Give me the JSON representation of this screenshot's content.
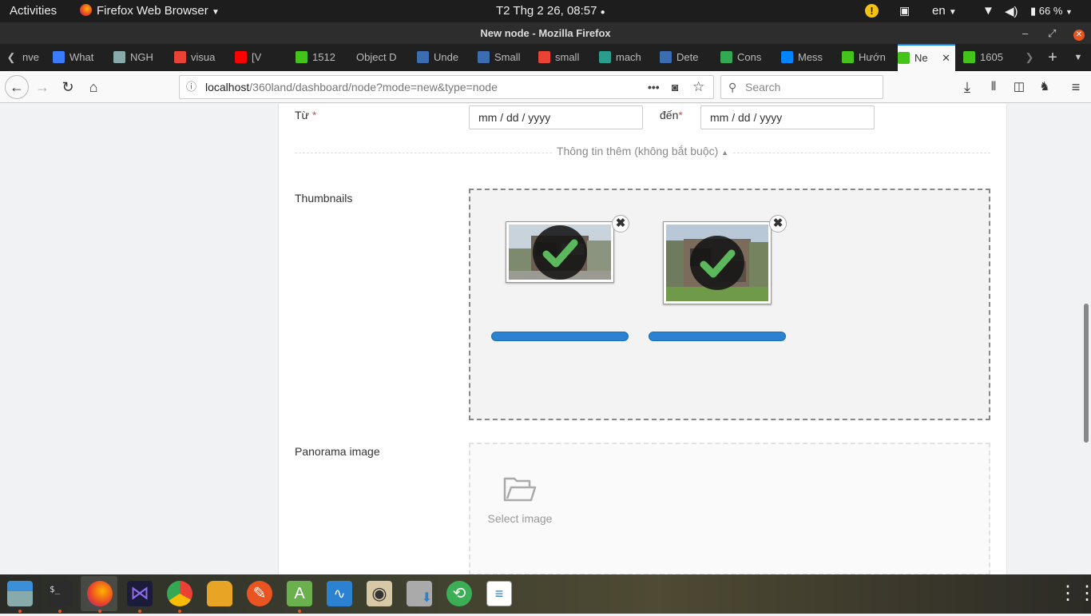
{
  "topbar": {
    "activities": "Activities",
    "app_name": "Firefox Web Browser",
    "clock": "T2 Thg 2 26, 08:57",
    "lang": "en",
    "battery": "66 %"
  },
  "window": {
    "title": "New node - Mozilla Firefox"
  },
  "tabs": [
    {
      "label": "nve",
      "icon": "tab-icon",
      "color": "#444"
    },
    {
      "label": "What",
      "icon": "infinity-icon",
      "color": "#3b7cff"
    },
    {
      "label": "NGH",
      "icon": "doc-icon",
      "color": "#8aa"
    },
    {
      "label": "visua",
      "icon": "google-icon",
      "color": "#ea4335"
    },
    {
      "label": "[V",
      "icon": "youtube-icon",
      "color": "#ff0000"
    },
    {
      "label": "1512",
      "icon": "smiley-icon",
      "color": "#44c41a"
    },
    {
      "label": "Object D",
      "icon": "none",
      "color": ""
    },
    {
      "label": "Unde",
      "icon": "doc-icon",
      "color": "#3b6db0"
    },
    {
      "label": "Small",
      "icon": "chat-icon",
      "color": "#3b6db0"
    },
    {
      "label": "small",
      "icon": "google-icon",
      "color": "#ea4335"
    },
    {
      "label": "mach",
      "icon": "grid-icon",
      "color": "#2a9d8f"
    },
    {
      "label": "Dete",
      "icon": "chat-icon",
      "color": "#3b6db0"
    },
    {
      "label": "Cons",
      "icon": "map-pin-icon",
      "color": "#34a853"
    },
    {
      "label": "Mess",
      "icon": "messenger-icon",
      "color": "#0084ff"
    },
    {
      "label": "Hướn",
      "icon": "location-icon",
      "color": "#44c41a"
    },
    {
      "label": "Ne",
      "icon": "location-icon",
      "color": "#44c41a"
    },
    {
      "label": "1605",
      "icon": "smiley-icon",
      "color": "#44c41a"
    }
  ],
  "nav": {
    "url_host": "localhost",
    "url_path": "/360land/dashboard/node?mode=new&type=node",
    "search_placeholder": "Search"
  },
  "form": {
    "from_label": "Từ",
    "to_label": "đến",
    "required_mark": "*",
    "from_value": "mm / dd / yyyy",
    "to_value": "mm / dd / yyyy",
    "more_info": "Thông tin thêm (không bắt buộc)",
    "thumbnails_label": "Thumbnails",
    "panorama_label": "Panorama image",
    "select_image": "Select image"
  },
  "uploads": [
    {
      "name": "thumbnail-1",
      "progress": 1.0
    },
    {
      "name": "thumbnail-2",
      "progress": 1.0
    }
  ],
  "colors": {
    "accent": "#0a84ff",
    "progress": "#2a82d0",
    "check": "#5cb85c",
    "required": "#d9534f"
  }
}
